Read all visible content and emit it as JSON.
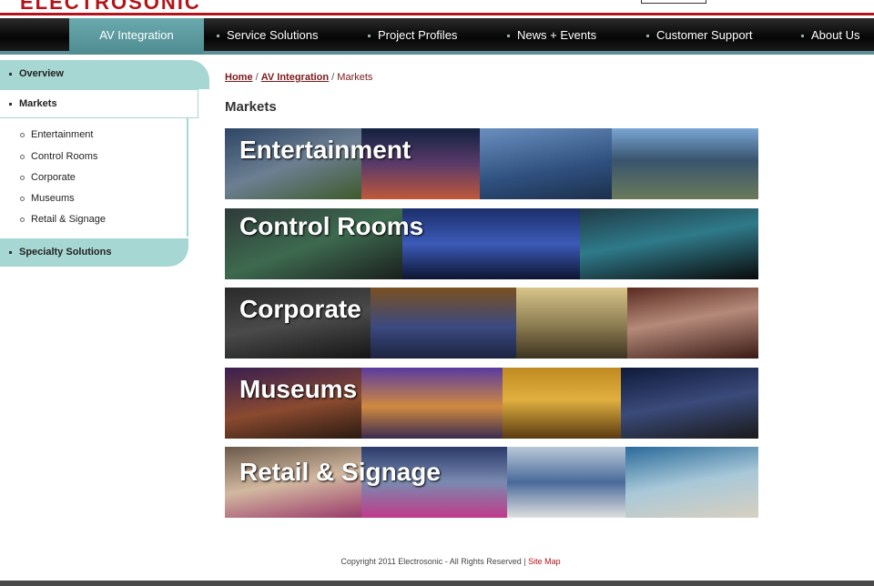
{
  "brand": {
    "logo_text": "ELECTROSONIC",
    "accent": "#b3141b",
    "teal": "#a7d7d3"
  },
  "nav": {
    "items": [
      {
        "label": "AV Integration",
        "active": true
      },
      {
        "label": "Service Solutions"
      },
      {
        "label": "Project Profiles"
      },
      {
        "label": "News + Events"
      },
      {
        "label": "Customer Support"
      },
      {
        "label": "About Us"
      }
    ]
  },
  "sidebar": {
    "overview": "Overview",
    "markets": "Markets",
    "sub_items": [
      "Entertainment",
      "Control Rooms",
      "Corporate",
      "Museums",
      "Retail & Signage"
    ],
    "specialty": "Specialty Solutions"
  },
  "breadcrumb": {
    "home": "Home",
    "sep": "/",
    "section": "AV Integration",
    "current": "Markets"
  },
  "page": {
    "title": "Markets"
  },
  "banners": [
    "Entertainment",
    "Control Rooms",
    "Corporate",
    "Museums",
    "Retail & Signage"
  ],
  "footer": {
    "copyright": "Copyright 2011 Electrosonic - All Rights Reserved |",
    "sitemap": "Site Map"
  }
}
